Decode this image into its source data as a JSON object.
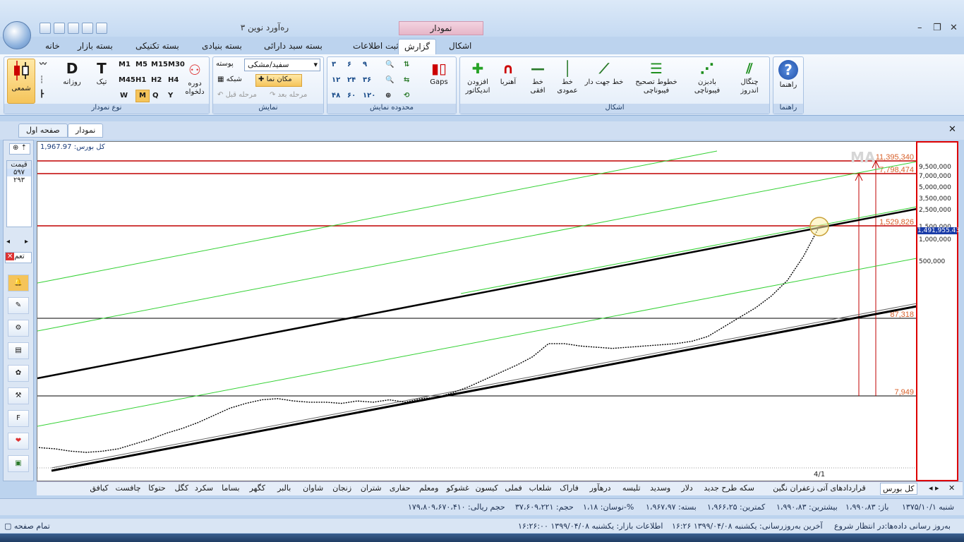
{
  "app": {
    "title": "ره‌آورد نوین ۳",
    "context_tab": "نمودار"
  },
  "ribbon_tabs": [
    "خانه",
    "بسته بازار",
    "بسته تکنیکی",
    "بسته بنیادی",
    "بسته سبد دارائی",
    "ثبت اطلاعات",
    "گزارش",
    "اشکال"
  ],
  "groups": {
    "chart_type": {
      "caption": "نوع نمودار",
      "candle": "شمعی",
      "daily": "روزانه",
      "tick": "تیک",
      "period": "دوره دلخواه",
      "periods": [
        "M1",
        "M5",
        "M15",
        "M30",
        "M45",
        "H1",
        "H2",
        "H4",
        "W",
        "M",
        "Q",
        "Y"
      ]
    },
    "display": {
      "caption": "نمایش",
      "theme": "سفید/مشکی",
      "shell": "پوسته",
      "cursor": "مکان نما",
      "grid": "شبکه",
      "next": "مرحله بعد",
      "prev": "مرحله قبل"
    },
    "range": {
      "caption": "محدوده نمایش",
      "gaps": "Gaps",
      "labels": [
        "۳",
        "۶",
        "۹",
        "۱۲",
        "۲۴",
        "۳۶",
        "۴۸",
        "۶۰",
        "۱۲۰"
      ]
    },
    "shapes": {
      "caption": "اشکال",
      "add_indicator": "افزودن اندیکاتور",
      "magnet": "آهنربا",
      "hline": "خط افقی",
      "vline": "خط عمودی",
      "trendline": "خط جهت دار",
      "fib_retr": "خطوط تصحیح فیبوناچی",
      "fib_fan": "بادبزن فیبوناچی",
      "andrews": "چنگال اندروز"
    },
    "help": {
      "caption": "راهنما",
      "label": "راهنما"
    }
  },
  "doc_tabs": [
    "نمودار",
    "صفحه اول"
  ],
  "left_panel": {
    "price_label": "قیمت",
    "v1": "۵۹۷",
    "v2": "۲۹۳",
    "close_label": "تعم"
  },
  "chart_data": {
    "type": "line",
    "title": "کل بورس: 1,967.97",
    "y_ticks": [
      "9,500,000",
      "7,000,000",
      "5,000,000",
      "3,500,000",
      "2,500,000",
      "1,500,000",
      "1,000,000",
      "500,000"
    ],
    "current_price": "1,491,955.43",
    "hlines": [
      {
        "value": "11,395,340"
      },
      {
        "value": "7,798,474"
      },
      {
        "value": "1,529,826"
      },
      {
        "value": "87,318"
      },
      {
        "value": "7,949"
      }
    ],
    "x_label": "4/1",
    "watermark": "MA",
    "series": [
      {
        "values": [
          0.15,
          0.14,
          0.12,
          0.11,
          0.12,
          0.14,
          0.18,
          0.22,
          0.27,
          0.31,
          0.36,
          0.42,
          0.48,
          0.52,
          0.55,
          0.56,
          0.54,
          0.53,
          0.53,
          0.52,
          0.54,
          0.53,
          0.55,
          0.53,
          0.56,
          0.57,
          0.61,
          0.66,
          0.72,
          0.78,
          0.84,
          0.91,
          1.02,
          1.02,
          1.0,
          0.99,
          0.98,
          0.99,
          1.0,
          1.01,
          1.02,
          1.04,
          1.08,
          1.16,
          1.24,
          1.32,
          1.42,
          1.55,
          1.75,
          2.0
        ]
      }
    ]
  },
  "symbols": [
    "کل بورس",
    "قراردادهای آتی زعفران نگین",
    "سکه طرح جدید",
    "دلار",
    "وسدید",
    "تلیسه",
    "درهآور",
    "فاراک",
    "شلعاب",
    "فملی",
    "کیسون",
    "غشوکو",
    "ومعلم",
    "حفاری",
    "شتران",
    "زنجان",
    "شاوان",
    "بالبر",
    "کگهر",
    "بساما",
    "سکرد",
    "کگل",
    "حتوکا",
    "چافست",
    "کیافق"
  ],
  "status": {
    "date": "شنبه ۱۳۷۵/۱۰/۱",
    "open": "باز: ۱،۹۹۰،۸۳",
    "high": "بیشترین: ۱،۹۹۰،۸۳",
    "low": "کمترین: ۱،۹۶۶،۲۵",
    "close": "بسته: ۱،۹۶۷،۹۷",
    "change": "نوسان: ۱،۱۸-%",
    "volume": "حجم: ۳۷،۶۰۹،۲۲۱",
    "value": "حجم ریالی: ۱۷۹،۸۰۹،۶۷۰،۴۱۰"
  },
  "status2": {
    "update": "به‌روز رسانی داده‌ها:در انتظار شروع",
    "last_update": "آخرین به‌روزرسانی: یکشنبه ۱۳۹۹/۰۴/۰۸ ۱۶:۲۶",
    "market": "اطلاعات بازار: یکشنبه ۱۳۹۹/۰۴/۰۸ ۱۶:۲۶:۰۰",
    "fullscreen": "تمام صفحه"
  },
  "colors": {
    "accent": "#f0b43c",
    "red": "#c00000",
    "green": "#34d134"
  }
}
